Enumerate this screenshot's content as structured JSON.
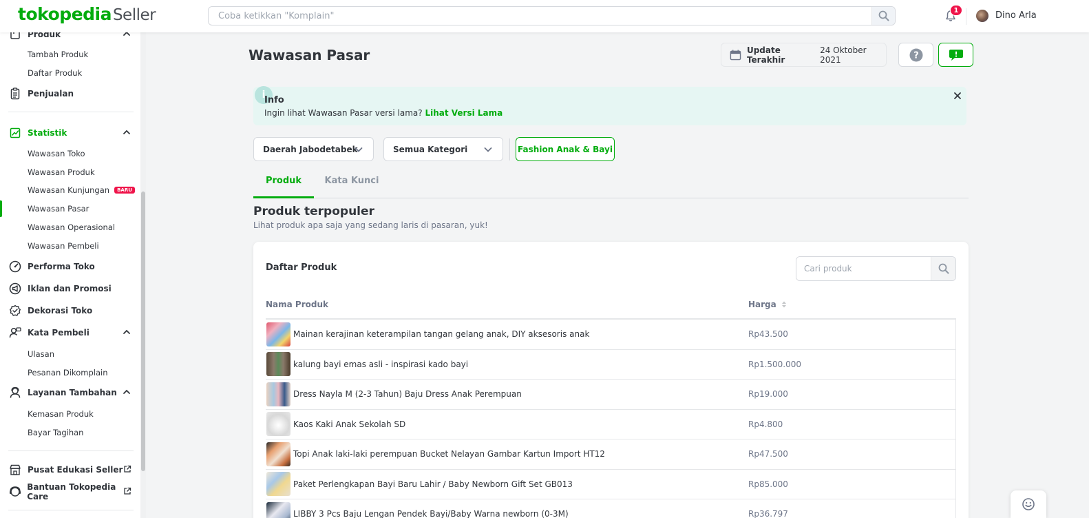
{
  "header": {
    "logo": "tokopedia",
    "logo_suffix": "Seller",
    "search_placeholder": "Coba ketikkan \"Komplain\"",
    "notification_count": "1",
    "user_name": "Dino Arla"
  },
  "sidebar": {
    "produk": {
      "label": "Produk",
      "items": [
        "Tambah Produk",
        "Daftar Produk"
      ]
    },
    "penjualan": "Penjualan",
    "statistik": {
      "label": "Statistik",
      "items": [
        "Wawasan Toko",
        "Wawasan Produk",
        "Wawasan Kunjungan",
        "Wawasan Pasar",
        "Wawasan Operasional",
        "Wawasan Pembeli"
      ],
      "new_badge": "BARU"
    },
    "performa": "Performa Toko",
    "iklan": "Iklan dan Promosi",
    "dekorasi": "Dekorasi Toko",
    "kata_pembeli": {
      "label": "Kata Pembeli",
      "items": [
        "Ulasan",
        "Pesanan Dikomplain"
      ]
    },
    "layanan": {
      "label": "Layanan Tambahan",
      "items": [
        "Kemasan Produk",
        "Bayar Tagihan"
      ]
    },
    "edukasi": "Pusat Edukasi Seller",
    "bantuan": "Bantuan Tokopedia Care"
  },
  "main": {
    "title": "Wawasan Pasar",
    "update_label": "Update Terakhir",
    "update_date": "24 Oktober 2021",
    "info": {
      "title": "Info",
      "text": "Ingin lihat Wawasan Pasar versi lama?",
      "link": "Lihat Versi Lama"
    },
    "filters": {
      "region": "Daerah Jabodetabek",
      "category": "Semua Kategori",
      "chip": "Fashion Anak & Bayi"
    },
    "tabs": [
      "Produk",
      "Kata Kunci"
    ],
    "section_title": "Produk terpopuler",
    "section_subtitle": "Lihat produk apa saja yang sedang laris di pasaran, yuk!",
    "card_title": "Daftar Produk",
    "product_search_placeholder": "Cari produk",
    "columns": [
      "Nama Produk",
      "Harga"
    ],
    "products": [
      {
        "name": "Mainan kerajinan keterampilan tangan gelang anak, DIY aksesoris anak",
        "price": "Rp43.500"
      },
      {
        "name": "kalung bayi emas asli - inspirasi kado bayi",
        "price": "Rp1.500.000"
      },
      {
        "name": "Dress Nayla M (2-3 Tahun) Baju Dress Anak Perempuan",
        "price": "Rp19.000"
      },
      {
        "name": "Kaos Kaki Anak Sekolah SD",
        "price": "Rp4.800"
      },
      {
        "name": "Topi Anak laki-laki perempuan Bucket Nelayan Gambar Kartun Import HT12",
        "price": "Rp47.500"
      },
      {
        "name": "Paket Perlengkapan Bayi Baru Lahir / Baby Newborn Gift Set GB013",
        "price": "Rp85.000"
      },
      {
        "name": "LIBBY 3 Pcs Baju Lengan Pendek Bayi/Baby Warna newborn (0-3M)",
        "price": "Rp36.797"
      }
    ]
  },
  "colors": {
    "brand": "#03ac0e",
    "badge": "#ef144a",
    "info_bg": "#e6f6f3"
  }
}
